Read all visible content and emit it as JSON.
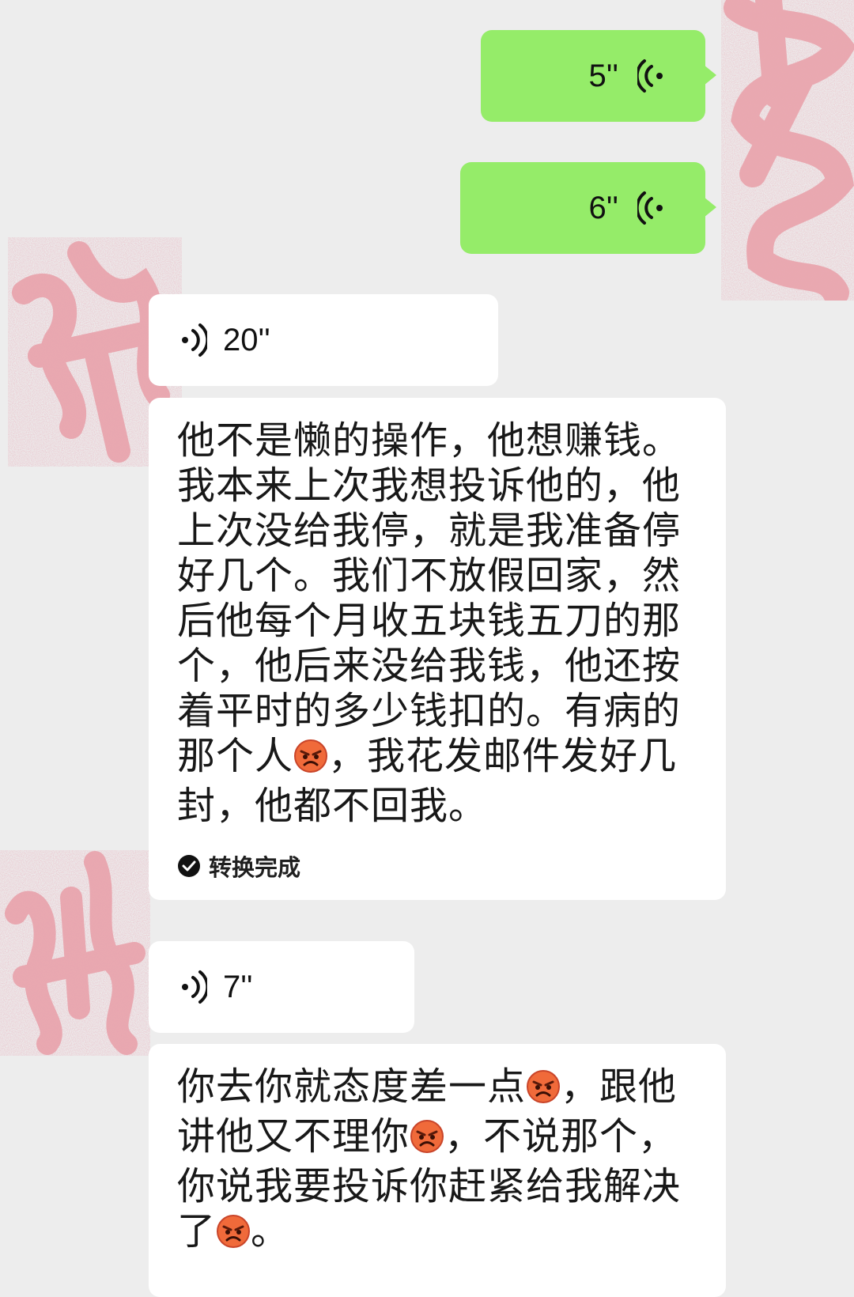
{
  "messages": {
    "out1": {
      "duration": "5''",
      "icon": "voice-wave-icon"
    },
    "out2": {
      "duration": "6''",
      "icon": "voice-wave-icon"
    },
    "in1": {
      "duration": "20''",
      "icon": "voice-wave-icon",
      "transcript_parts": [
        "他不是懒的操作，他想赚钱。我本来上次我想投诉他的，他上次没给我停，就是我准备停好几个。我们不放假回家，然后他每个月收五块钱五刀的那个，他后来没给我钱，他还按着平时的多少钱扣的。有病的那个人",
        "，我花发邮件发好几封，他都不回我。"
      ],
      "emoji": "angry-face-emoji",
      "status_label": "转换完成"
    },
    "in2": {
      "duration": "7''",
      "icon": "voice-wave-icon",
      "transcript_parts": [
        "你去你就态度差一点",
        "，跟他讲他又不理你",
        "，不说那个，你说我要投诉你赶紧给我解决了",
        "。"
      ],
      "emoji": "angry-face-emoji"
    }
  },
  "colors": {
    "background": "#ededed",
    "outgoing_bubble": "#95ec69",
    "incoming_bubble": "#ffffff",
    "avatar_scribble": "#e8a0a8"
  }
}
